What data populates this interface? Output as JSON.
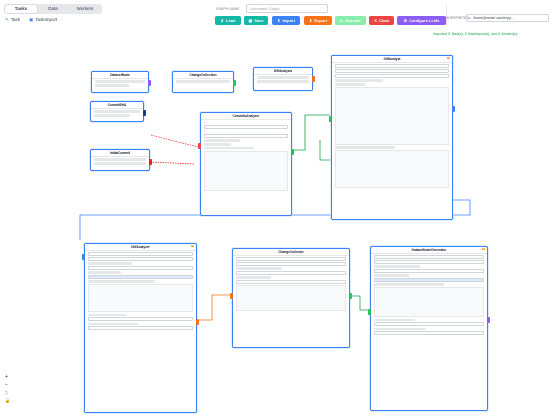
{
  "header": {
    "tabs": [
      {
        "label": "Tasks"
      },
      {
        "label": "Data"
      },
      {
        "label": "Workers"
      }
    ],
    "subtabs": [
      {
        "label": "Task"
      },
      {
        "label": "TaskImport"
      }
    ],
    "graph_name_label": "GRAPH NAME",
    "graph_name_placeholder": "Unnamed Graph",
    "buttons": [
      {
        "label": "Load",
        "color": "#14b8a6"
      },
      {
        "label": "Save",
        "color": "#14b8a6"
      },
      {
        "label": "Import",
        "color": "#3b82f6"
      },
      {
        "label": "Export",
        "color": "#f97316"
      },
      {
        "label": "Execute",
        "color": "#86efac"
      },
      {
        "label": "Clear",
        "color": "#ef4444"
      },
      {
        "label": "Configure LLMs",
        "color": "#8b5cf6"
      }
    ],
    "interpreter_label": "INTERPRETER",
    "interpreter_value": "/home/jimmie/.cache/py...",
    "status": "Imported 5 Task(s), 0 TaskImport(s), and 5 Worker(s)."
  },
  "nodes": {
    "n1": {
      "title": "DatasetNode"
    },
    "n2": {
      "title": "ChangeCollection"
    },
    "n3": {
      "title": "DiffAnalysis"
    },
    "n4": {
      "title": "CommitSHA"
    },
    "n5": {
      "title": "InitialCommit"
    },
    "n6": {
      "title": "CommitsAnalyzer"
    },
    "n7": {
      "title": "DiffAnalyst"
    },
    "n8": {
      "title": "DiffAnalyzer"
    },
    "n9": {
      "title": "ChangeCollector"
    },
    "n10": {
      "title": "DatasetNodeGenerator"
    }
  },
  "zoom": {
    "plus": "+",
    "minus": "−",
    "fit": "⛶",
    "lock": "🔓"
  }
}
